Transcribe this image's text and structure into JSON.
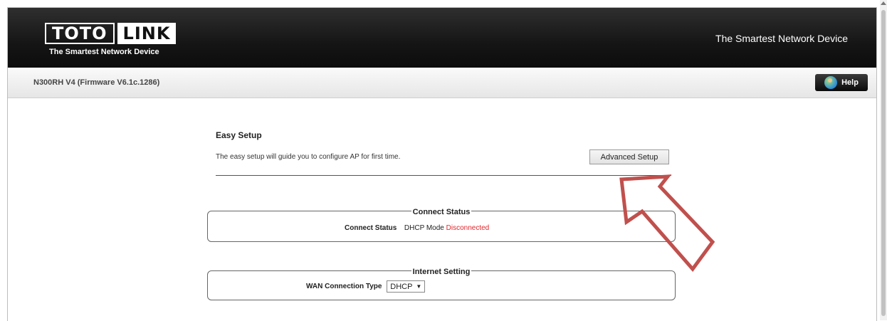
{
  "header": {
    "logo_toto": "TOTO",
    "logo_link": "LINK",
    "logo_sub": "The Smartest Network Device",
    "tagline": "The Smartest Network Device"
  },
  "subbar": {
    "model": "N300RH V4 (Firmware V6.1c.1286)",
    "help_label": "Help"
  },
  "main": {
    "title": "Easy Setup",
    "description": "The easy setup will guide you to configure AP for first time.",
    "advanced_button": "Advanced Setup"
  },
  "connect_status": {
    "legend": "Connect Status",
    "label": "Connect Status",
    "mode": "DHCP Mode",
    "status": "Disconnected",
    "status_color": "#e0262b"
  },
  "internet_setting": {
    "legend": "Internet Setting",
    "label": "WAN Connection Type",
    "selected": "DHCP",
    "arrow": "▼"
  },
  "annotation": {
    "arrow_color": "#c0504d"
  }
}
